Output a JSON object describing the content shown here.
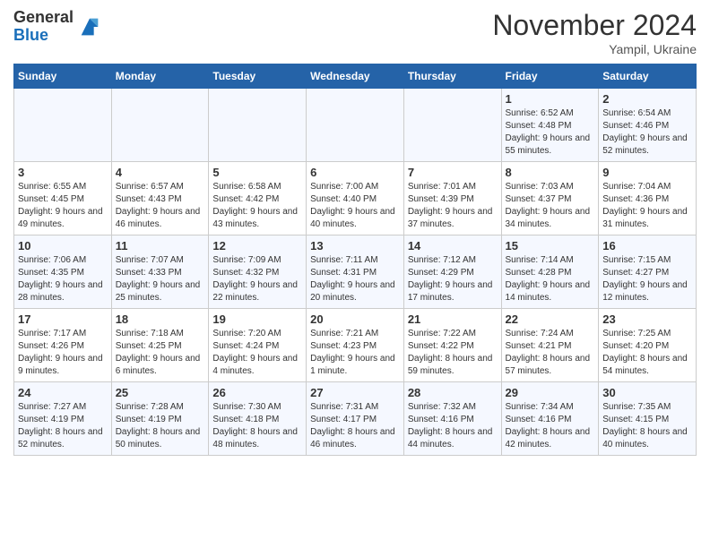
{
  "logo": {
    "general": "General",
    "blue": "Blue"
  },
  "title": {
    "month": "November 2024",
    "location": "Yampil, Ukraine"
  },
  "headers": [
    "Sunday",
    "Monday",
    "Tuesday",
    "Wednesday",
    "Thursday",
    "Friday",
    "Saturday"
  ],
  "weeks": [
    [
      {
        "day": "",
        "info": ""
      },
      {
        "day": "",
        "info": ""
      },
      {
        "day": "",
        "info": ""
      },
      {
        "day": "",
        "info": ""
      },
      {
        "day": "",
        "info": ""
      },
      {
        "day": "1",
        "info": "Sunrise: 6:52 AM\nSunset: 4:48 PM\nDaylight: 9 hours and 55 minutes."
      },
      {
        "day": "2",
        "info": "Sunrise: 6:54 AM\nSunset: 4:46 PM\nDaylight: 9 hours and 52 minutes."
      }
    ],
    [
      {
        "day": "3",
        "info": "Sunrise: 6:55 AM\nSunset: 4:45 PM\nDaylight: 9 hours and 49 minutes."
      },
      {
        "day": "4",
        "info": "Sunrise: 6:57 AM\nSunset: 4:43 PM\nDaylight: 9 hours and 46 minutes."
      },
      {
        "day": "5",
        "info": "Sunrise: 6:58 AM\nSunset: 4:42 PM\nDaylight: 9 hours and 43 minutes."
      },
      {
        "day": "6",
        "info": "Sunrise: 7:00 AM\nSunset: 4:40 PM\nDaylight: 9 hours and 40 minutes."
      },
      {
        "day": "7",
        "info": "Sunrise: 7:01 AM\nSunset: 4:39 PM\nDaylight: 9 hours and 37 minutes."
      },
      {
        "day": "8",
        "info": "Sunrise: 7:03 AM\nSunset: 4:37 PM\nDaylight: 9 hours and 34 minutes."
      },
      {
        "day": "9",
        "info": "Sunrise: 7:04 AM\nSunset: 4:36 PM\nDaylight: 9 hours and 31 minutes."
      }
    ],
    [
      {
        "day": "10",
        "info": "Sunrise: 7:06 AM\nSunset: 4:35 PM\nDaylight: 9 hours and 28 minutes."
      },
      {
        "day": "11",
        "info": "Sunrise: 7:07 AM\nSunset: 4:33 PM\nDaylight: 9 hours and 25 minutes."
      },
      {
        "day": "12",
        "info": "Sunrise: 7:09 AM\nSunset: 4:32 PM\nDaylight: 9 hours and 22 minutes."
      },
      {
        "day": "13",
        "info": "Sunrise: 7:11 AM\nSunset: 4:31 PM\nDaylight: 9 hours and 20 minutes."
      },
      {
        "day": "14",
        "info": "Sunrise: 7:12 AM\nSunset: 4:29 PM\nDaylight: 9 hours and 17 minutes."
      },
      {
        "day": "15",
        "info": "Sunrise: 7:14 AM\nSunset: 4:28 PM\nDaylight: 9 hours and 14 minutes."
      },
      {
        "day": "16",
        "info": "Sunrise: 7:15 AM\nSunset: 4:27 PM\nDaylight: 9 hours and 12 minutes."
      }
    ],
    [
      {
        "day": "17",
        "info": "Sunrise: 7:17 AM\nSunset: 4:26 PM\nDaylight: 9 hours and 9 minutes."
      },
      {
        "day": "18",
        "info": "Sunrise: 7:18 AM\nSunset: 4:25 PM\nDaylight: 9 hours and 6 minutes."
      },
      {
        "day": "19",
        "info": "Sunrise: 7:20 AM\nSunset: 4:24 PM\nDaylight: 9 hours and 4 minutes."
      },
      {
        "day": "20",
        "info": "Sunrise: 7:21 AM\nSunset: 4:23 PM\nDaylight: 9 hours and 1 minute."
      },
      {
        "day": "21",
        "info": "Sunrise: 7:22 AM\nSunset: 4:22 PM\nDaylight: 8 hours and 59 minutes."
      },
      {
        "day": "22",
        "info": "Sunrise: 7:24 AM\nSunset: 4:21 PM\nDaylight: 8 hours and 57 minutes."
      },
      {
        "day": "23",
        "info": "Sunrise: 7:25 AM\nSunset: 4:20 PM\nDaylight: 8 hours and 54 minutes."
      }
    ],
    [
      {
        "day": "24",
        "info": "Sunrise: 7:27 AM\nSunset: 4:19 PM\nDaylight: 8 hours and 52 minutes."
      },
      {
        "day": "25",
        "info": "Sunrise: 7:28 AM\nSunset: 4:19 PM\nDaylight: 8 hours and 50 minutes."
      },
      {
        "day": "26",
        "info": "Sunrise: 7:30 AM\nSunset: 4:18 PM\nDaylight: 8 hours and 48 minutes."
      },
      {
        "day": "27",
        "info": "Sunrise: 7:31 AM\nSunset: 4:17 PM\nDaylight: 8 hours and 46 minutes."
      },
      {
        "day": "28",
        "info": "Sunrise: 7:32 AM\nSunset: 4:16 PM\nDaylight: 8 hours and 44 minutes."
      },
      {
        "day": "29",
        "info": "Sunrise: 7:34 AM\nSunset: 4:16 PM\nDaylight: 8 hours and 42 minutes."
      },
      {
        "day": "30",
        "info": "Sunrise: 7:35 AM\nSunset: 4:15 PM\nDaylight: 8 hours and 40 minutes."
      }
    ]
  ]
}
